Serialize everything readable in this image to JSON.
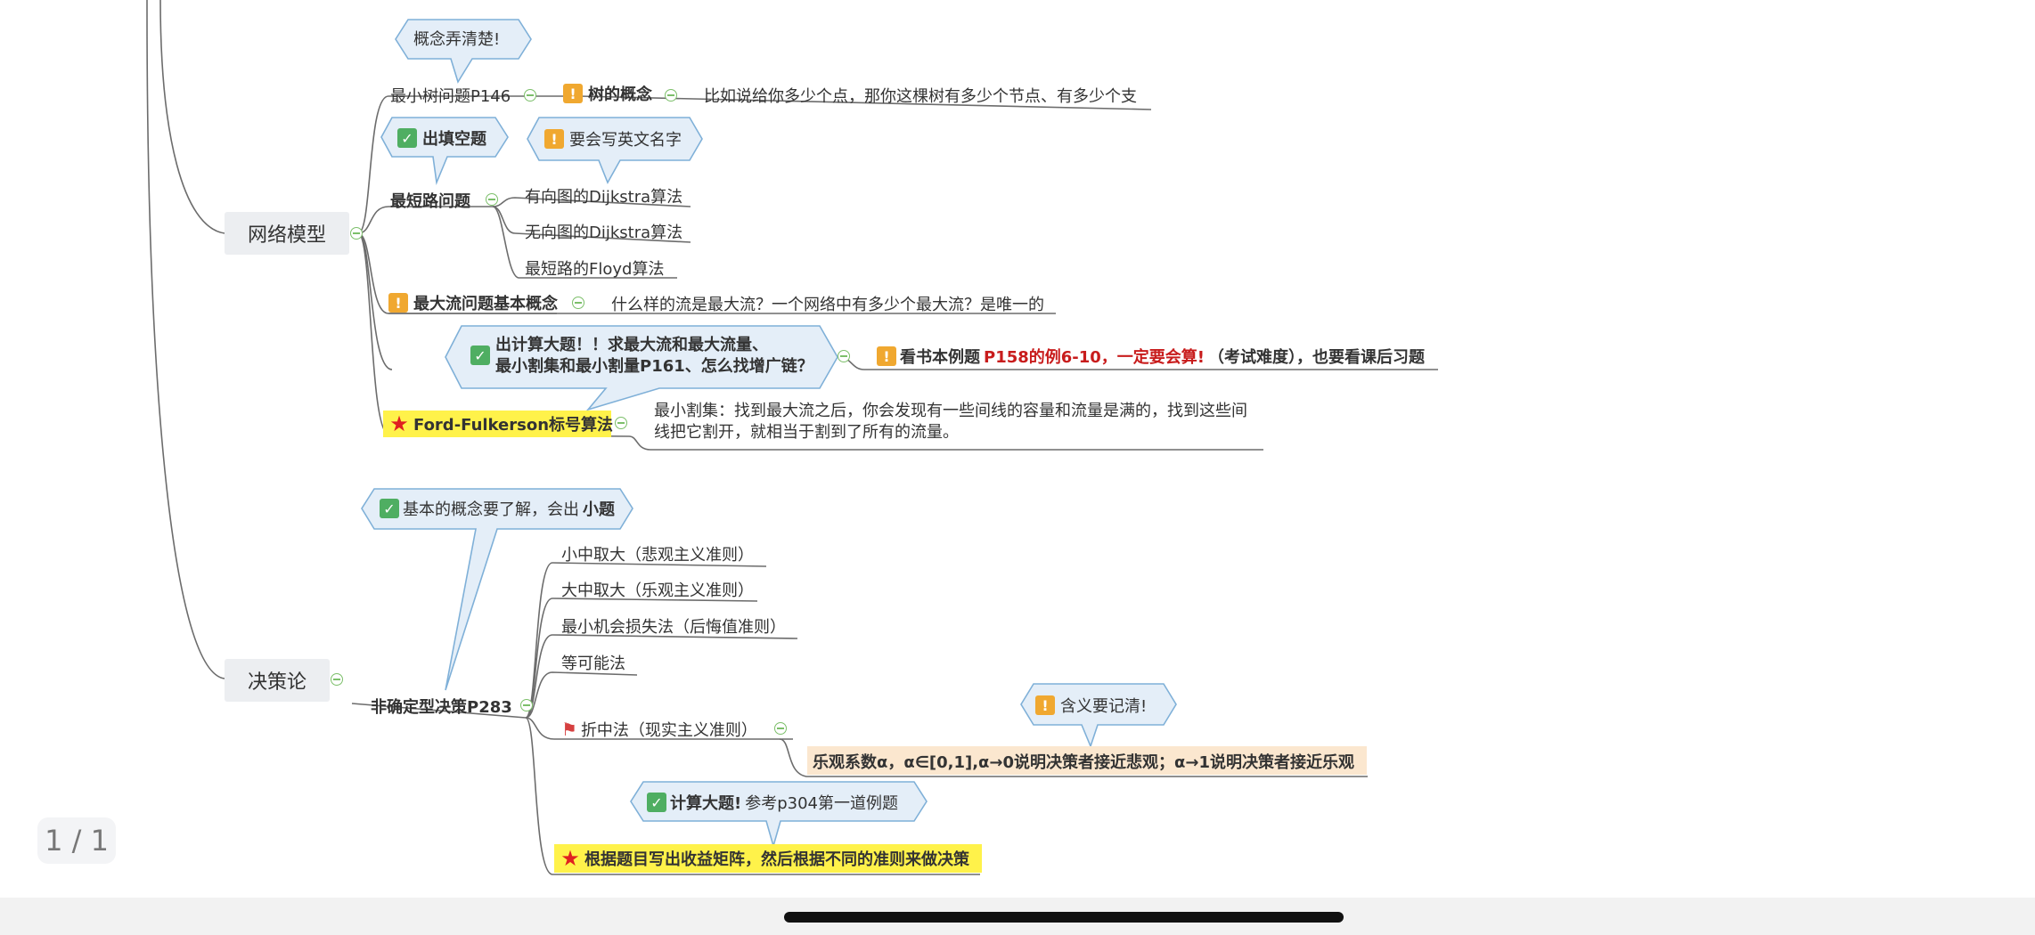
{
  "network": {
    "title": "网络模型",
    "min_tree": {
      "label": "最小树问题P146",
      "callout": "概念弄清楚!",
      "concept": "树的概念",
      "concept_note": "比如说给你多少个点，那你这棵树有多少个节点、有多少个支"
    },
    "shortest": {
      "label": "最短路问题",
      "callout": "出填空题",
      "callout2": "要会写英文名字",
      "items": [
        "有向图的Dijkstra算法",
        "无向图的Dijkstra算法",
        "最短路的Floyd算法"
      ]
    },
    "maxflow_concept": {
      "label": "最大流问题基本概念",
      "note": "什么样的流是最大流？一个网络中有多少个最大流？是唯一的"
    },
    "ff": {
      "label": "Ford-Fulkerson标号算法",
      "callout_line1": "出计算大题！！求最大流和最大流量、",
      "callout_line2": "最小割集和最小割量P161、怎么找增广链？",
      "exam_prefix": "看书本例题",
      "exam_red": "P158的例6-10，一定要会算!",
      "exam_suffix": "（考试难度），也要看课后习题",
      "cut_line1": "最小割集：找到最大流之后，你会发现有一些间线的容量和流量是满的，找到这些间",
      "cut_line2": "线把它割开，就相当于割到了所有的流量。"
    }
  },
  "decision": {
    "title": "决策论",
    "uncertain": {
      "label": "非确定型决策P283",
      "callout_prefix": "基本的概念要了解，会出",
      "callout_bold": "小题",
      "items": [
        "小中取大（悲观主义准则）",
        "大中取大（乐观主义准则）",
        "最小机会损失法（后悔值准则）",
        "等可能法"
      ],
      "compromise": "折中法（现实主义准则）",
      "compromise_callout": "含义要记清!",
      "compromise_note": "乐观系数α，α∈[0,1],α→0说明决策者接近悲观；α→1说明决策者接近乐观",
      "calc_callout_bold": "计算大题!",
      "calc_callout_rest": "参考p304第一道例题",
      "matrix": "根据题目写出收益矩阵，然后根据不同的准则来做决策"
    }
  },
  "page_indicator": "1 / 1",
  "colors": {
    "callout_fill": "#e4eef8",
    "callout_border": "#7fb0d8",
    "highlight_yellow": "#fff24a",
    "highlight_beige": "#fbe7cf",
    "red_text": "#c81c1c",
    "collapse_green": "#7cbf6a"
  },
  "icons": {
    "warning": "exclamation-icon",
    "check": "check-icon",
    "star": "star-icon",
    "flag": "flag-icon",
    "collapse": "minus-circle-icon"
  }
}
